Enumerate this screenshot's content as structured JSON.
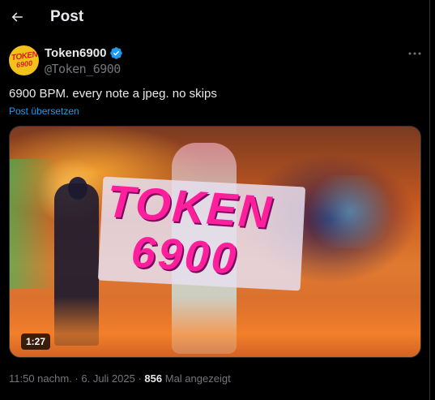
{
  "header": {
    "title": "Post"
  },
  "tweet": {
    "display_name": "Token6900",
    "handle": "@Token_6900",
    "avatar_text_line1": "TOKEN",
    "avatar_text_line2": "6900",
    "text": "6900 BPM. every note a jpeg. no skips",
    "translate_label": "Post übersetzen",
    "media": {
      "sign_line1": "TOKEN",
      "sign_line2": "6900",
      "duration": "1:27"
    },
    "timestamp": "11:50 nachm. · 6. Juli 2025 ·",
    "views_count": "856",
    "views_label": "Mal angezeigt"
  },
  "icons": {
    "back": "arrow-left-icon",
    "verified": "verified-badge-icon",
    "more": "more-horizontal-icon"
  },
  "colors": {
    "background": "#000000",
    "text_primary": "#e7e9ea",
    "text_secondary": "#71767b",
    "accent": "#1d9bf0"
  }
}
